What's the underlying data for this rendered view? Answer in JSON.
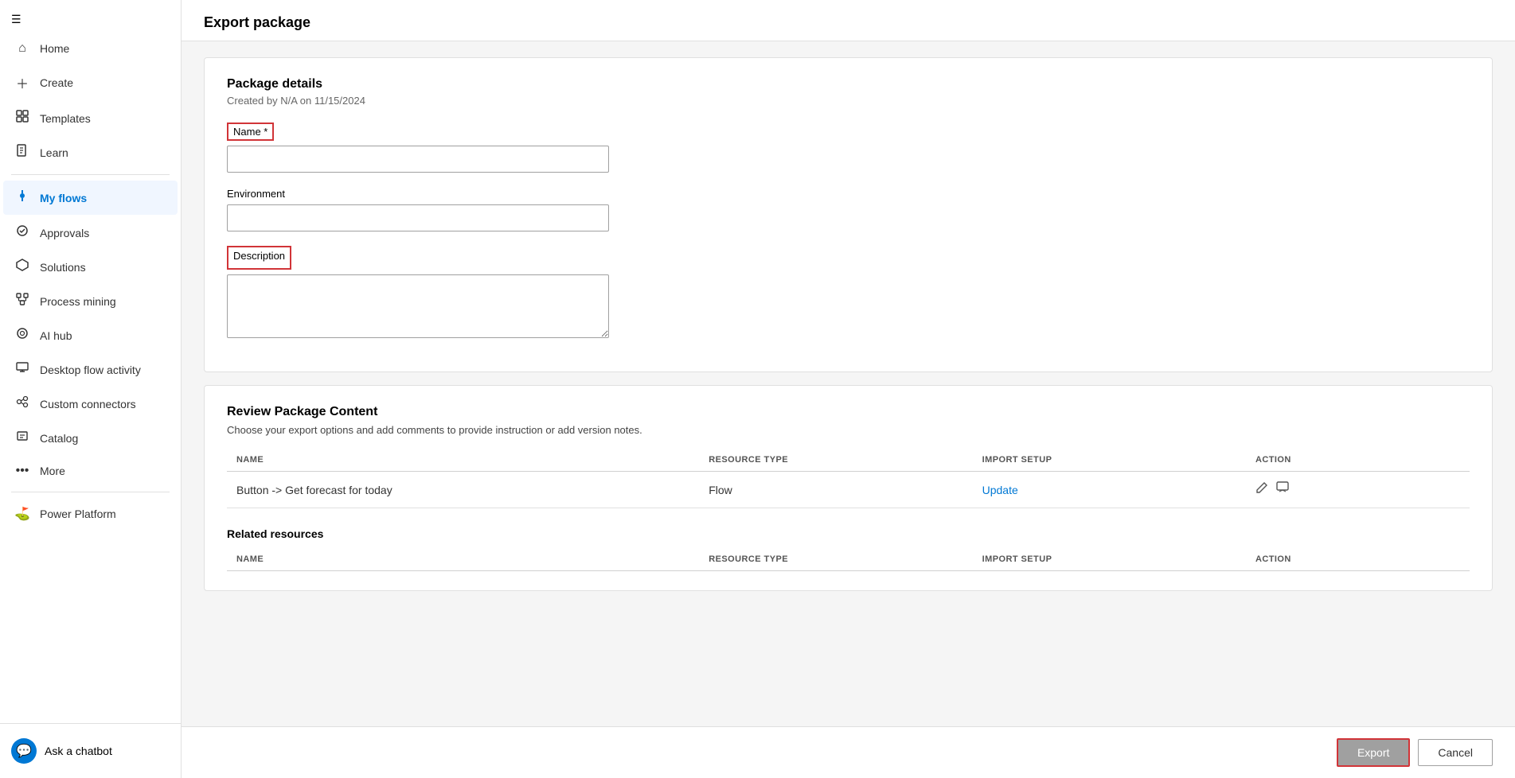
{
  "sidebar": {
    "hamburger_icon": "☰",
    "items": [
      {
        "id": "home",
        "label": "Home",
        "icon": "⌂",
        "active": false
      },
      {
        "id": "create",
        "label": "Create",
        "icon": "+",
        "active": false
      },
      {
        "id": "templates",
        "label": "Templates",
        "icon": "📋",
        "active": false
      },
      {
        "id": "learn",
        "label": "Learn",
        "icon": "📖",
        "active": false
      },
      {
        "id": "my-flows",
        "label": "My flows",
        "icon": "💧",
        "active": true
      },
      {
        "id": "approvals",
        "label": "Approvals",
        "icon": "✔",
        "active": false
      },
      {
        "id": "solutions",
        "label": "Solutions",
        "icon": "🧩",
        "active": false
      },
      {
        "id": "process-mining",
        "label": "Process mining",
        "icon": "⬡",
        "active": false
      },
      {
        "id": "ai-hub",
        "label": "AI hub",
        "icon": "◎",
        "active": false
      },
      {
        "id": "desktop-flow-activity",
        "label": "Desktop flow activity",
        "icon": "🖥",
        "active": false
      },
      {
        "id": "custom-connectors",
        "label": "Custom connectors",
        "icon": "⚙",
        "active": false
      },
      {
        "id": "catalog",
        "label": "Catalog",
        "icon": "📦",
        "active": false
      },
      {
        "id": "more",
        "label": "More",
        "icon": "⋯",
        "active": false
      },
      {
        "id": "power-platform",
        "label": "Power Platform",
        "icon": "⛳",
        "active": false
      }
    ],
    "chatbot_label": "Ask a chatbot"
  },
  "page": {
    "title": "Export package",
    "package_details": {
      "section_title": "Package details",
      "created_info": "Created by N/A on 11/15/2024",
      "name_label": "Name *",
      "name_placeholder": "",
      "environment_label": "Environment",
      "environment_placeholder": "",
      "description_label": "Description",
      "description_placeholder": ""
    },
    "review_content": {
      "section_title": "Review Package Content",
      "section_desc": "Choose your export options and add comments to provide instruction or add version notes.",
      "table_headers": {
        "name": "NAME",
        "resource_type": "RESOURCE TYPE",
        "import_setup": "IMPORT SETUP",
        "action": "ACTION"
      },
      "table_rows": [
        {
          "name": "Button -> Get forecast for today",
          "resource_type": "Flow",
          "import_setup": "Update",
          "action": ""
        }
      ]
    },
    "related_resources": {
      "section_title": "Related resources",
      "table_headers": {
        "name": "NAME",
        "resource_type": "RESOURCE TYPE",
        "import_setup": "IMPORT SETUP",
        "action": "ACTION"
      }
    },
    "buttons": {
      "export_label": "Export",
      "cancel_label": "Cancel"
    }
  }
}
